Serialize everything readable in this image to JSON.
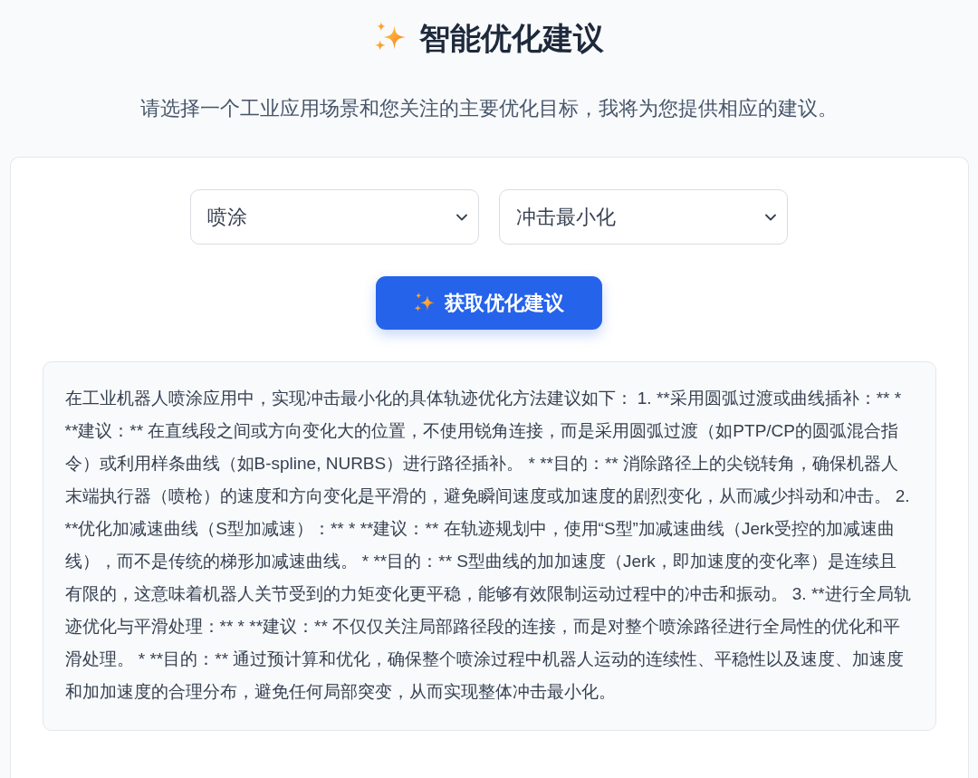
{
  "header": {
    "title": "智能优化建议",
    "subtitle": "请选择一个工业应用场景和您关注的主要优化目标，我将为您提供相应的建议。"
  },
  "form": {
    "dropdowns": [
      {
        "value": "喷涂"
      },
      {
        "value": "冲击最小化"
      }
    ],
    "submit_button": {
      "label": "获取优化建议"
    }
  },
  "result": {
    "text": "在工业机器人喷涂应用中，实现冲击最小化的具体轨迹优化方法建议如下： 1. **采用圆弧过渡或曲线插补：** * **建议：** 在直线段之间或方向变化大的位置，不使用锐角连接，而是采用圆弧过渡（如PTP/CP的圆弧混合指令）或利用样条曲线（如B-spline, NURBS）进行路径插补。 * **目的：** 消除路径上的尖锐转角，确保机器人末端执行器（喷枪）的速度和方向变化是平滑的，避免瞬间速度或加速度的剧烈变化，从而减少抖动和冲击。 2. **优化加减速曲线（S型加减速）：** * **建议：** 在轨迹规划中，使用“S型”加减速曲线（Jerk受控的加减速曲线），而不是传统的梯形加减速曲线。 * **目的：** S型曲线的加加速度（Jerk，即加速度的变化率）是连续且有限的，这意味着机器人关节受到的力矩变化更平稳，能够有效限制运动过程中的冲击和振动。 3. **进行全局轨迹优化与平滑处理：** * **建议：** 不仅仅关注局部路径段的连接，而是对整个喷涂路径进行全局性的优化和平滑处理。 * **目的：** 通过预计算和优化，确保整个喷涂过程中机器人运动的连续性、平稳性以及速度、加速度和加加速度的合理分布，避免任何局部突变，从而实现整体冲击最小化。"
  }
}
